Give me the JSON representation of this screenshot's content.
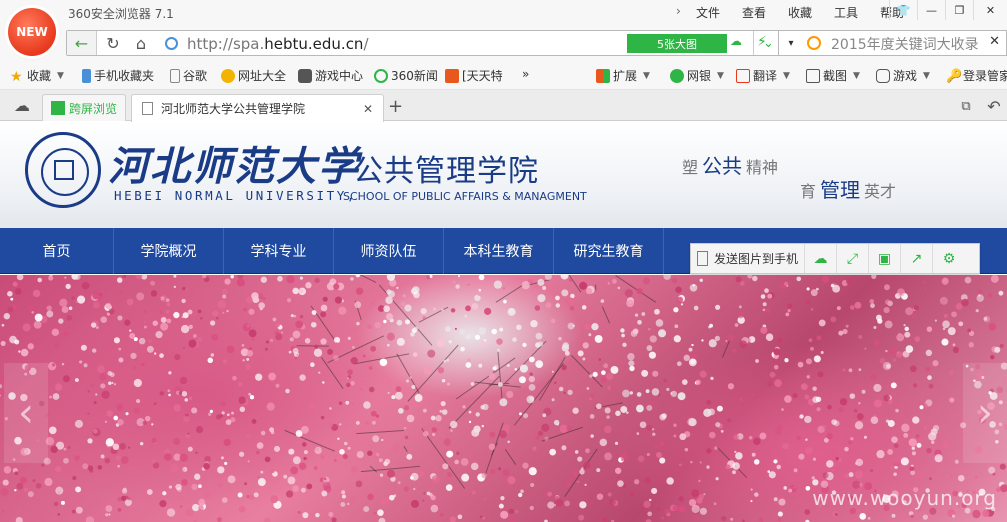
{
  "browser": {
    "app_title": "360安全浏览器 7.1",
    "new_badge": "NEW",
    "menu": [
      "文件",
      "查看",
      "收藏",
      "工具",
      "帮助"
    ],
    "address": {
      "url_prefix": "http://spa.",
      "url_domain": "hebtu.edu.cn",
      "url_suffix": "/",
      "big_image_button": "5张大图"
    },
    "search": {
      "placeholder": "2015年度关键词大收录"
    },
    "bookmarks": [
      "收藏",
      "手机收藏夹",
      "谷歌",
      "网址大全",
      "游戏中心",
      "360新闻",
      "[天天特",
      "»",
      "扩展",
      "网银",
      "翻译",
      "截图",
      "游戏",
      "登录管家"
    ],
    "tabs": {
      "side_tab": "跨屏浏览",
      "active_tab": "河北师范大学公共管理学院"
    }
  },
  "page": {
    "header": {
      "university_cn": "河北师范大学",
      "school_cn": "公共管理学院",
      "university_en": "HEBEI NORMAL UNIVERSITY,",
      "school_en": "SCHOOL OF PUBLIC AFFAIRS & MANAGMENT",
      "motto_line1_a": "塑",
      "motto_line1_b": "公共",
      "motto_line1_c": "精神",
      "motto_line2_a": "育",
      "motto_line2_b": "管理",
      "motto_line2_c": "英才"
    },
    "nav": [
      "首页",
      "学院概况",
      "学科专业",
      "师资队伍",
      "本科生教育",
      "研究生教育"
    ],
    "image_toolbar": {
      "send_to_phone": "发送图片到手机"
    },
    "watermark": "www.wooyun.org"
  },
  "colors": {
    "brand_blue": "#1a3b86",
    "nav_blue": "#1f4aa0",
    "accent_green": "#2fb546"
  }
}
